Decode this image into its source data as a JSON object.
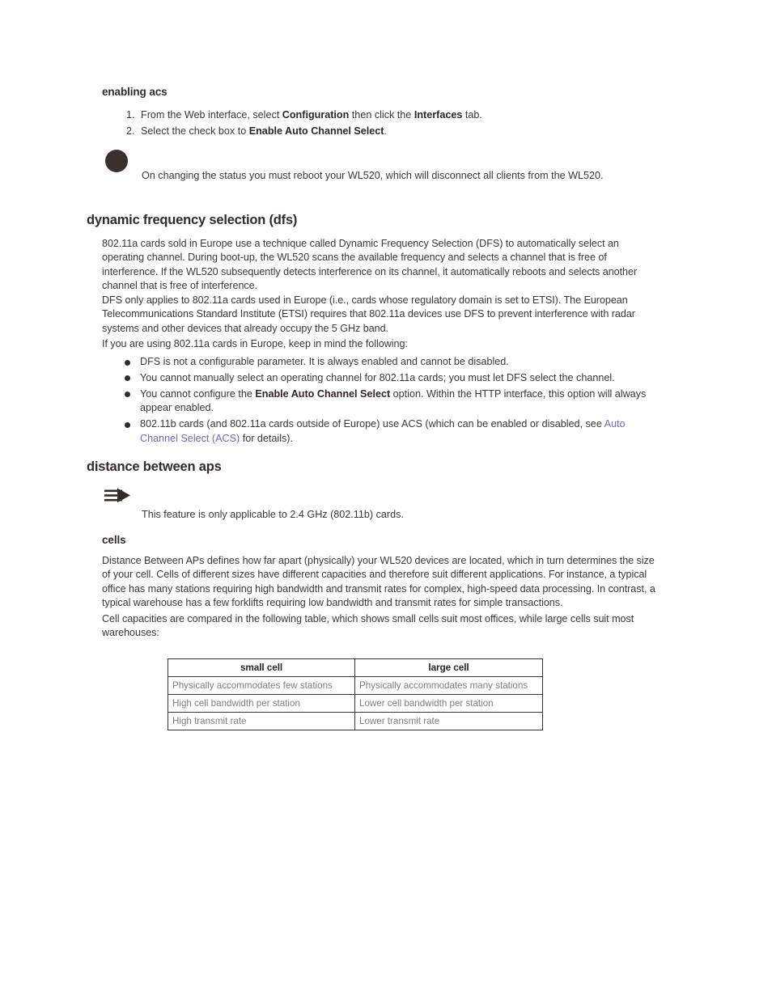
{
  "sections": {
    "enabling_acs": {
      "heading": "enabling acs",
      "steps": [
        {
          "number": "1.",
          "parts": [
            {
              "t": "From the Web interface, select ",
              "s": "normal"
            },
            {
              "t": "Configuration",
              "s": "bold"
            },
            {
              "t": " then click the ",
              "s": "normal"
            },
            {
              "t": "Interfaces",
              "s": "bold"
            },
            {
              "t": " tab.",
              "s": "normal"
            }
          ]
        },
        {
          "number": "2.",
          "parts": [
            {
              "t": "Select the check box to ",
              "s": "normal"
            },
            {
              "t": "Enable Auto Channel Select",
              "s": "bold"
            },
            {
              "t": ".",
              "s": "normal"
            }
          ]
        }
      ],
      "note": {
        "icon": "caution-circle-icon",
        "text": "On changing the status you must reboot your WL520, which will disconnect all clients from the WL520."
      }
    },
    "dfs": {
      "heading": "dynamic frequency selection (dfs)",
      "paragraphs": [
        "802.11a cards sold in Europe use a technique called Dynamic Frequency Selection (DFS) to automatically select an operating channel. During boot-up, the WL520 scans the available frequency and selects a channel that is free of interference. If the WL520 subsequently detects interference on its channel, it automatically reboots and selects another channel that is free of interference.",
        "DFS only applies to 802.11a cards used in Europe (i.e., cards whose regulatory domain is set to ETSI). The European Telecommunications Standard Institute (ETSI) requires that 802.11a devices use DFS to prevent interference with radar systems and other devices that already occupy the 5 GHz band.",
        "If you are using 802.11a cards in Europe, keep in mind the following:"
      ],
      "bullets": [
        {
          "parts": [
            {
              "t": "DFS is not a configurable parameter. It is always enabled and cannot be disabled.",
              "s": "normal"
            }
          ]
        },
        {
          "parts": [
            {
              "t": "You cannot manually select an operating channel for 802.11a cards; you must let DFS select the channel.",
              "s": "normal"
            }
          ]
        },
        {
          "parts": [
            {
              "t": "You cannot configure the ",
              "s": "normal"
            },
            {
              "t": "Enable Auto Channel Select",
              "s": "bold"
            },
            {
              "t": " option. Within the HTTP interface, this option will always appear enabled.",
              "s": "normal"
            }
          ]
        },
        {
          "parts": [
            {
              "t": "802.11b cards (and 802.11a cards outside of Europe) use ACS (which can be enabled or disabled, see ",
              "s": "normal"
            },
            {
              "t": "Auto Channel Select (ACS)",
              "s": "link"
            },
            {
              "t": " for details).",
              "s": "normal"
            }
          ]
        }
      ]
    },
    "distance_between_aps": {
      "heading": "distance between aps",
      "note": {
        "icon": "note-arrow-icon",
        "text": "This feature is only applicable to 2.4 GHz (802.11b) cards."
      },
      "cells": {
        "heading": "cells",
        "paragraphs": [
          "Distance Between APs defines how far apart (physically) your WL520 devices are located, which in turn determines the size of your cell. Cells of different sizes have different capacities and therefore suit different applications. For instance, a typical office has many stations requiring high bandwidth and transmit rates for complex, high-speed data processing. In contrast, a typical warehouse has a few forklifts requiring low bandwidth and transmit rates for simple transactions.",
          "Cell capacities are compared in the following table, which shows small cells suit most offices, while large cells suit most warehouses:"
        ],
        "table": {
          "headers": [
            "small cell",
            "large cell"
          ],
          "rows": [
            [
              "Physically accommodates few stations",
              "Physically accommodates many stations"
            ],
            [
              "High cell bandwidth per station",
              "Lower cell bandwidth per station"
            ],
            [
              "High transmit rate",
              "Lower transmit rate"
            ]
          ]
        }
      }
    }
  },
  "colors": {
    "text": "#3d3633",
    "heading": "#332b28",
    "link": "#7a6aa8",
    "table_border": "#3a3330",
    "table_body_text": "#7f7d7c"
  }
}
